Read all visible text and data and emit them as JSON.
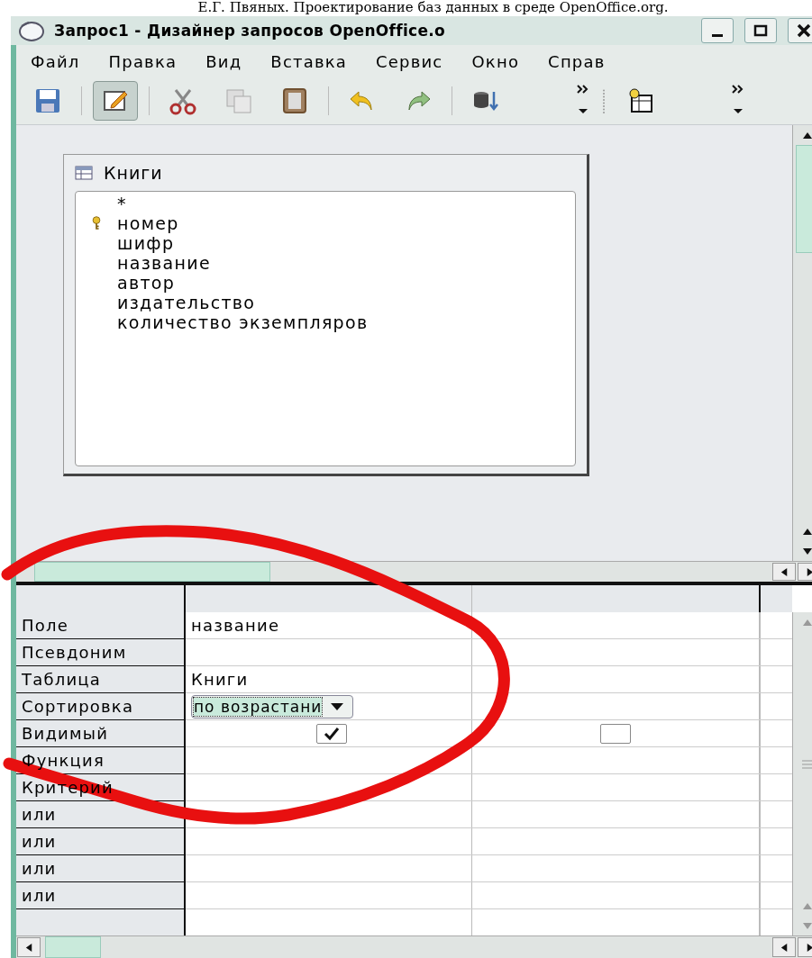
{
  "caption": "Е.Г. Пвяных. Проектирование баз данных в среде OpenOffice.org.",
  "window": {
    "title": "Запрос1 - Дизайнер запросов OpenOffice.o"
  },
  "menu": [
    "Файл",
    "Правка",
    "Вид",
    "Вставка",
    "Сервис",
    "Окно",
    "Справ"
  ],
  "toolbar": [
    {
      "kind": "save",
      "selected": false
    },
    {
      "kind": "sep"
    },
    {
      "kind": "edit",
      "selected": true
    },
    {
      "kind": "sep"
    },
    {
      "kind": "cut",
      "selected": false
    },
    {
      "kind": "copy",
      "selected": false
    },
    {
      "kind": "paste",
      "selected": false
    },
    {
      "kind": "sep"
    },
    {
      "kind": "undo",
      "selected": false
    },
    {
      "kind": "redo",
      "selected": false
    },
    {
      "kind": "sep"
    },
    {
      "kind": "dbsort",
      "selected": false
    },
    {
      "kind": "more"
    },
    {
      "kind": "grip"
    },
    {
      "kind": "addtable",
      "selected": false
    },
    {
      "kind": "more"
    }
  ],
  "table_window": {
    "title": "Книги",
    "fields": [
      {
        "name": "*",
        "key": false
      },
      {
        "name": "номер",
        "key": true
      },
      {
        "name": "шифр",
        "key": false
      },
      {
        "name": "название",
        "key": false
      },
      {
        "name": "автор",
        "key": false
      },
      {
        "name": "издательство",
        "key": false
      },
      {
        "name": "количество экземпляров",
        "key": false
      }
    ]
  },
  "grid": {
    "rows": [
      {
        "label": "Поле",
        "kind": "text",
        "value": "название"
      },
      {
        "label": "Псевдоним",
        "kind": "text"
      },
      {
        "label": "Таблица",
        "kind": "text",
        "value": "Книги"
      },
      {
        "label": "Сортировка",
        "kind": "dropdown",
        "value": "по возрастани"
      },
      {
        "label": "Видимый",
        "kind": "checkbox",
        "checked": [
          true,
          false
        ]
      },
      {
        "label": "Функция",
        "kind": "text"
      },
      {
        "label": "Критерий",
        "kind": "text"
      },
      {
        "label": "или",
        "kind": "text"
      },
      {
        "label": "или",
        "kind": "text"
      },
      {
        "label": "или",
        "kind": "text"
      },
      {
        "label": "или",
        "kind": "text"
      }
    ]
  },
  "annotation": {
    "kind": "ellipse"
  }
}
